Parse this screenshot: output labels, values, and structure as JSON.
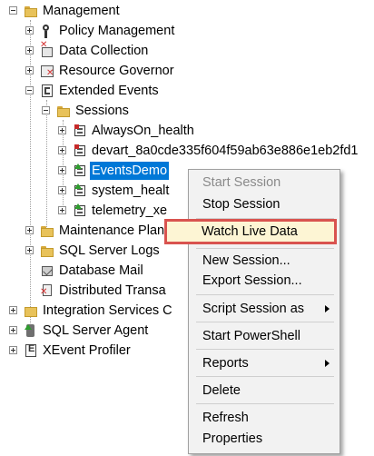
{
  "tree": {
    "management": "Management",
    "policy_management": "Policy Management",
    "data_collection": "Data Collection",
    "resource_governor": "Resource Governor",
    "extended_events": "Extended Events",
    "sessions": "Sessions",
    "session_alwayson": "AlwaysOn_health",
    "session_devart": "devart_8a0cde335f604f59ab63e886e1eb2fd1",
    "session_eventsdemo": "EventsDemo",
    "session_system_health": "system_healt",
    "session_telemetry": "telemetry_xe",
    "maintenance_plans": "Maintenance Plans",
    "sql_server_logs": "SQL Server Logs",
    "database_mail": "Database Mail",
    "distributed_transactions": "Distributed Transa",
    "integration_services": "Integration Services C",
    "sql_server_agent": "SQL Server Agent",
    "xevent_profiler": "XEvent Profiler"
  },
  "context_menu": {
    "start_session": "Start Session",
    "stop_session": "Stop Session",
    "watch_live_data": "Watch Live Data",
    "new_session": "New Session...",
    "export_session": "Export Session...",
    "script_session_as": "Script Session as",
    "start_powershell": "Start PowerShell",
    "reports": "Reports",
    "delete": "Delete",
    "refresh": "Refresh",
    "properties": "Properties"
  },
  "colors": {
    "selection": "#0078d7",
    "highlight_border": "#d9534f",
    "highlight_fill": "#fdf5d4"
  }
}
